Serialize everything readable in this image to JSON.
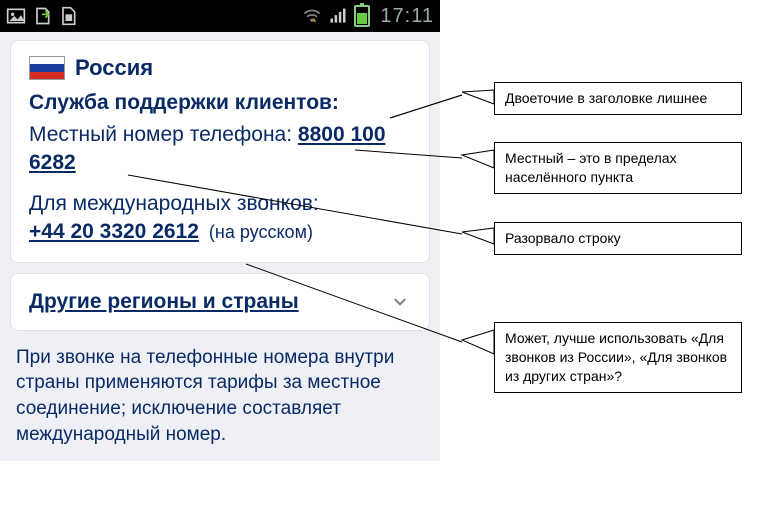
{
  "status": {
    "time": "17:11"
  },
  "card": {
    "country": "Россия",
    "support_heading": "Служба поддержки клиентов:",
    "local_label": "Местный номер телефона:",
    "local_phone": "8800 100 6282",
    "intl_label": "Для международных звонков:",
    "intl_phone": "+44 20 3320 2612",
    "lang_note": "(на русском)"
  },
  "expander": {
    "label": "Другие регионы и страны"
  },
  "footnote": "При звонке на телефонные номера внутри страны применяются тарифы за местное соединение; исключение составляет международный номер.",
  "annotations": {
    "a1": "Двоеточие в заголовке лишнее",
    "a2": "Местный – это в пределах населённого пункта",
    "a3": "Разорвало строку",
    "a4": "Может, лучше использовать «Для звонков из России», «Для звонков из других стран»?"
  }
}
